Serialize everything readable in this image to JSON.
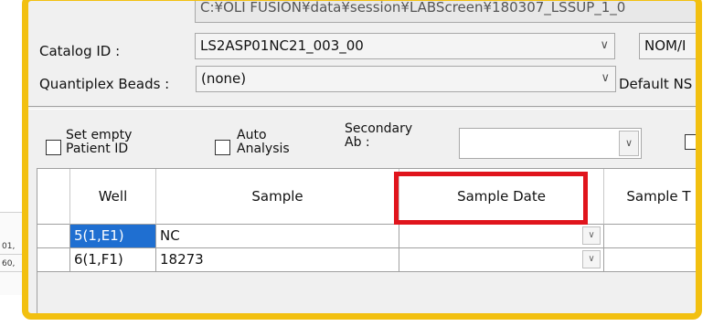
{
  "top_field": {
    "value": "C:¥OLI FUSION¥data¥session¥LABScreen¥180307_LSSUP_1_0"
  },
  "catalog": {
    "label": "Catalog ID :",
    "value": "LS2ASP01NC21_003_00",
    "nom": "NOM/I"
  },
  "quantiplex": {
    "label": "Quantiplex Beads :",
    "value": "(none)",
    "default_ns": "Default NS"
  },
  "options": {
    "set_empty_line1": "Set empty",
    "set_empty_line2": "Patient ID",
    "auto_line1": "Auto",
    "auto_line2": "Analysis",
    "secondary_line1": "Secondary",
    "secondary_line2": "Ab :"
  },
  "grid": {
    "headers": [
      "Well",
      "Sample",
      "Sample Date",
      "Sample T"
    ],
    "rows": [
      {
        "well": "5(1,E1)",
        "sample": "NC",
        "selected": true
      },
      {
        "well": "6(1,F1)",
        "sample": "18273",
        "selected": false
      }
    ]
  },
  "background": {
    "left_rows": [
      "01,",
      "60,"
    ]
  },
  "colors": {
    "highlight_frame": "#f2c010",
    "callout_box": "#e0141c",
    "selection": "#1f6fd1"
  },
  "icons": {
    "dropdown": "chevron-down-icon",
    "checkbox": "checkbox-icon"
  }
}
